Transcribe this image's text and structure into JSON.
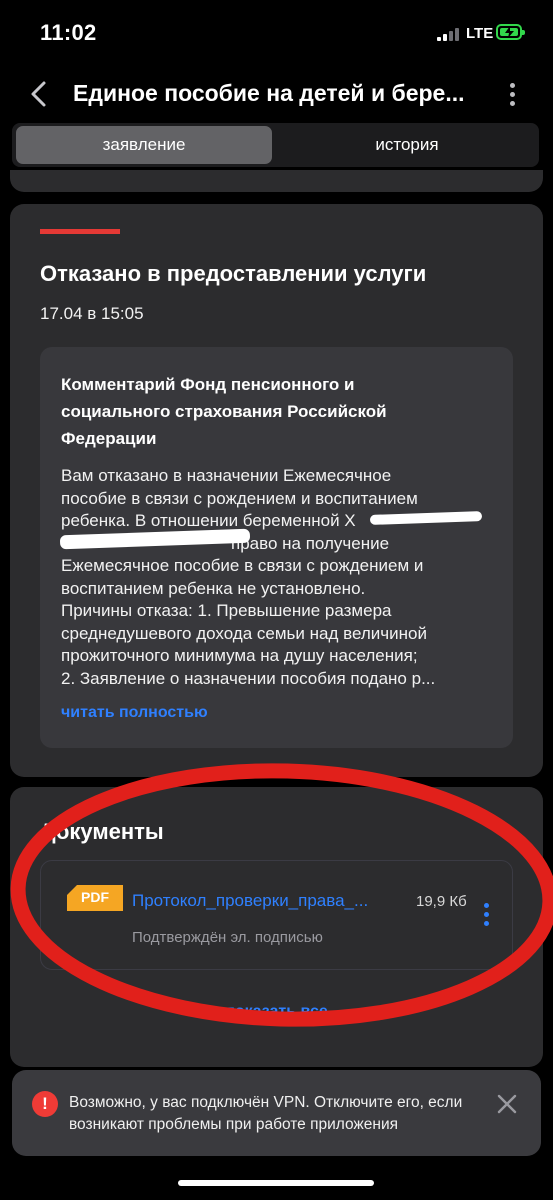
{
  "status_bar": {
    "time": "11:02",
    "network": "LTE"
  },
  "header": {
    "title": "Единое пособие на детей и бере..."
  },
  "tabs": [
    {
      "label": "заявление",
      "active": true
    },
    {
      "label": "история",
      "active": false
    }
  ],
  "status_card": {
    "heading": "Отказано в предоставлении услуги",
    "date": "17.04 в 15:05",
    "accent_color": "#e53935",
    "comment": {
      "title": "Комментарий Фонд пенсионного и социального страхования Российской Федерации",
      "lines": [
        "Вам отказано в назначении Ежемесячное",
        "пособие в связи с рождением и воспитанием",
        "ребенка. В отношении беременной Х",
        "право на получение",
        "Ежемесячное пособие в связи с рождением и",
        "воспитанием ребенка не установлено.",
        "Причины отказа: 1. Превышение размера",
        "среднедушевого дохода семьи над величиной",
        "прожиточного минимума на душу населения;",
        "2. Заявление о назначении пособия подано р..."
      ],
      "read_more": "читать полностью"
    }
  },
  "documents": {
    "title": "Документы",
    "items": [
      {
        "badge": "PDF",
        "name": "Протокол_проверки_права_...",
        "size": "19,9 Кб",
        "note": "Подтверждён эл. подписью"
      }
    ],
    "show_all": "показать все"
  },
  "toast": {
    "text": "Возможно, у вас подключён VPN. Отключите его, если возникают проблемы при работе приложения",
    "icon": "alert-icon"
  },
  "colors": {
    "link": "#2f80ff",
    "error": "#e53935",
    "annotation": "#e1201b",
    "pdf_badge": "#f5a623"
  }
}
